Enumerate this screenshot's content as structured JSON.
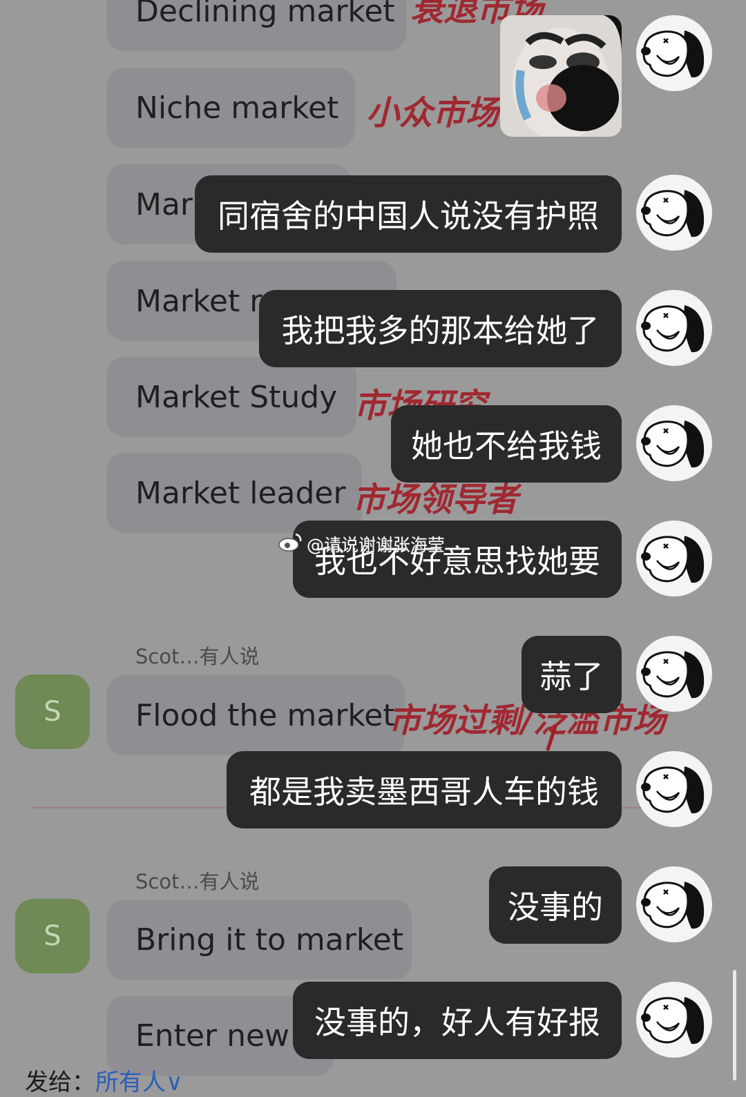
{
  "background_messages": [
    {
      "text": "Declining market",
      "note": "衰退市场"
    },
    {
      "text": "Niche market",
      "note": "小众市场"
    },
    {
      "text": "Mar"
    },
    {
      "text": "Market re"
    },
    {
      "text": "Market Study",
      "note": "市场研究"
    },
    {
      "text": "Market leader",
      "note": "市场领导者"
    },
    {
      "text": "Flood the market",
      "note": "市场过剩/泛滥市场",
      "sender": "Scot…有人说",
      "avatar": "S"
    },
    {
      "text": "Bring it to market",
      "sender": "Scot…有人说",
      "avatar": "S"
    },
    {
      "text": "Enter new f"
    }
  ],
  "overlay_messages": [
    {
      "text": "同宿舍的中国人说没有护照"
    },
    {
      "text": "我把我多的那本给她了"
    },
    {
      "text": "她也不给我钱"
    },
    {
      "text": "我也不好意思找她要"
    },
    {
      "text": "蒜了"
    },
    {
      "text": "都是我卖墨西哥人车的钱"
    },
    {
      "text": "没事的"
    },
    {
      "text": "没事的，好人有好报"
    }
  ],
  "watermark": "@请说谢谢张海莹",
  "footer": {
    "label": "发给：",
    "target": "所有人",
    "arrow": "∨"
  },
  "colors": {
    "handwriting": "#a11c26",
    "dark_bubble": "#2a2a2c",
    "sender_avatar": "#6f8a55"
  }
}
